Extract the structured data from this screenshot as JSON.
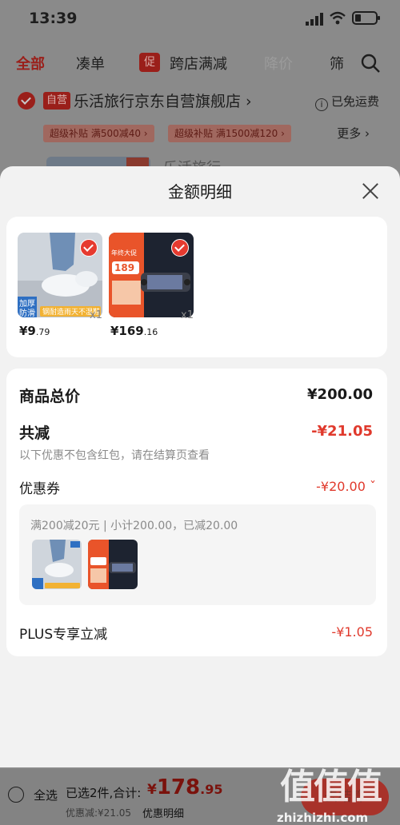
{
  "status_bar": {
    "time": "13:39"
  },
  "tabs": {
    "all": "全部",
    "bundle": "凑单",
    "promo_badge": "促",
    "cross_store": "跨店满减",
    "price_drop": "降价",
    "filter": "筛"
  },
  "store": {
    "badge": "自营",
    "name": "乐活旅行京东自营旗舰店 ›",
    "shipping": "已免运费",
    "shipping_icon": "i",
    "subsidy_1": "超级补贴  满500减40 ›",
    "subsidy_2": "超级补贴  满1500减120 ›",
    "more": "更多 ›",
    "bg_item_text": "乐活旅行"
  },
  "sheet": {
    "title": "金额明细",
    "products": [
      {
        "price_int": "¥9",
        "price_dec": ".79",
        "qty": "x1",
        "img_label_1": "加厚",
        "img_label_2": "防滑",
        "img_banner": "钢耐造雨天不湿鞋"
      },
      {
        "price_int": "¥169",
        "price_dec": ".16",
        "qty": "x1",
        "img_label_1": "年终大促",
        "img_label_2": "189"
      }
    ],
    "total_label": "商品总价",
    "total_value": "¥200.00",
    "reduce_label": "共减",
    "reduce_value": "-¥21.05",
    "hint": "以下优惠不包含红包，请在结算页查看",
    "coupon_label": "优惠券",
    "coupon_value": "-¥20.00 ˇ",
    "coupon_desc": "满200减20元 | 小计200.00，已减20.00",
    "plus_label": "PLUS专享立减",
    "plus_value": "-¥1.05"
  },
  "bottom_bar": {
    "select_all": "全选",
    "selected_count": "已选2件,合计:",
    "total_currency": "¥",
    "total_int": "178",
    "total_dec": ".95",
    "discount": "优惠减:¥21.05",
    "detail_link": "优惠明细",
    "checkout": "去结算"
  },
  "watermark": {
    "chars": "值值值",
    "url": "zhizhizhi.com"
  },
  "colors": {
    "accent": "#e0392c",
    "sheet_bg": "#f2f2f2",
    "card_bg": "#ffffff",
    "overlay": "#7d7d7d"
  }
}
